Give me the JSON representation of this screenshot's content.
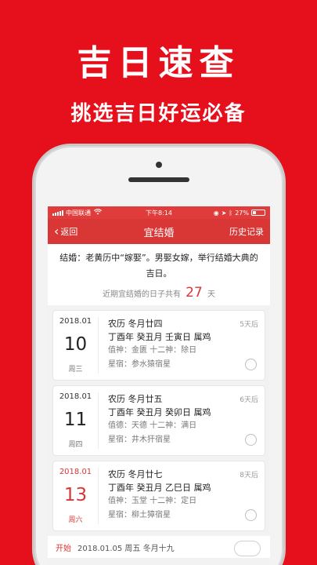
{
  "promo": {
    "title": "吉日速查",
    "subtitle": "挑选吉日好运必备"
  },
  "statusbar": {
    "carrier": "中国联通",
    "time": "下午8:14",
    "battery": "27%"
  },
  "navbar": {
    "back_label": "返回",
    "title": "宜结婚",
    "history_label": "历史记录"
  },
  "intro": {
    "description": "结婚：老黄历中“嫁娶”。男娶女嫁，举行结婚大典的吉日。",
    "summary_prefix": "近期宜结婚的日子共有",
    "count": "27",
    "summary_suffix": "天"
  },
  "days": [
    {
      "year_month": "2018.01",
      "day": "10",
      "weekday": "周三",
      "lunar": "农历  冬月廿四",
      "ganzhi": "丁酉年 癸丑月 壬寅日 属鸡",
      "duty": "值神：金匮  十二神：除日",
      "star": "星宿：参水猿宿星",
      "days_later": "5天后"
    },
    {
      "year_month": "2018.01",
      "day": "11",
      "weekday": "周四",
      "lunar": "农历  冬月廿五",
      "ganzhi": "丁酉年 癸丑月 癸卯日 属鸡",
      "duty": "值德：天德  十二神：满日",
      "star": "星宿：井木犴宿星",
      "days_later": "6天后"
    },
    {
      "year_month": "2018.01",
      "day": "13",
      "weekday": "周六",
      "lunar": "农历  冬月廿七",
      "ganzhi": "丁酉年 癸丑月 乙巳日 属鸡",
      "duty": "值神：玉堂  十二神：定日",
      "star": "星宿：柳土獐宿星",
      "days_later": "8天后"
    }
  ],
  "start_row": {
    "label": "开始",
    "value": "2018.01.05 周五 冬月十九"
  },
  "colors": {
    "brand_red": "#e60f1c",
    "nav_red": "#d93636"
  }
}
